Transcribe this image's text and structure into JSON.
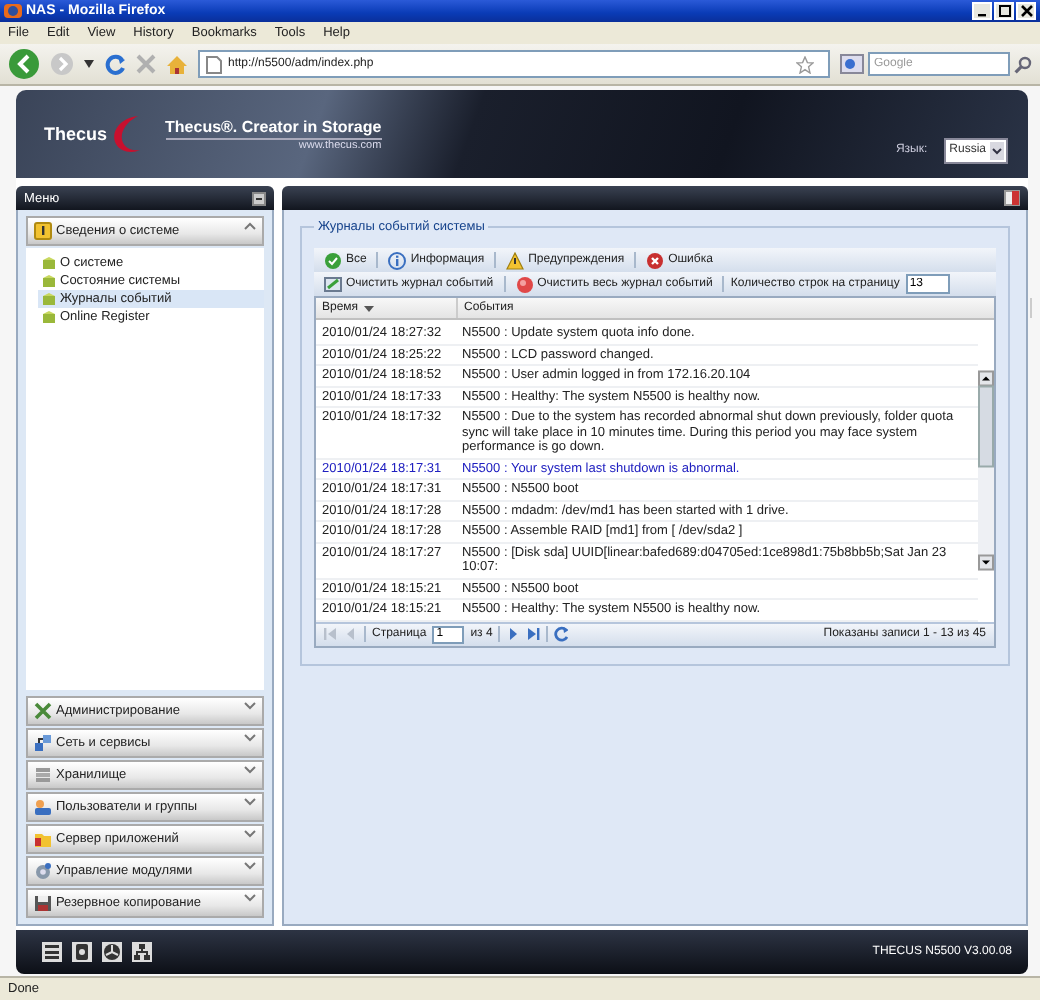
{
  "window": {
    "title": "NAS - Mozilla Firefox"
  },
  "menu_bar": [
    "File",
    "Edit",
    "View",
    "History",
    "Bookmarks",
    "Tools",
    "Help"
  ],
  "address_bar": {
    "url": "http://n5500/adm/index.php"
  },
  "search": {
    "placeholder": "Google"
  },
  "header": {
    "logo": "Thecus",
    "tagline": "Thecus®. Creator in Storage",
    "website": "www.thecus.com",
    "language_label": "Язык:",
    "language": "Russia"
  },
  "sidebar": {
    "title": "Меню",
    "sections": [
      {
        "label": "Сведения о системе",
        "expanded": true,
        "items": [
          {
            "label": "О системе",
            "selected": false
          },
          {
            "label": "Состояние системы",
            "selected": false
          },
          {
            "label": "Журналы событий",
            "selected": true
          },
          {
            "label": "Online Register",
            "selected": false
          }
        ]
      },
      {
        "label": "Администрирование",
        "expanded": false
      },
      {
        "label": "Сеть и сервисы",
        "expanded": false
      },
      {
        "label": "Хранилище",
        "expanded": false
      },
      {
        "label": "Пользователи и группы",
        "expanded": false
      },
      {
        "label": "Сервер приложений",
        "expanded": false
      },
      {
        "label": "Управление модулями",
        "expanded": false
      },
      {
        "label": "Резервное копирование",
        "expanded": false
      }
    ]
  },
  "log_panel": {
    "title": "Журналы событий системы",
    "filters": [
      {
        "kind": "all",
        "label": "Все"
      },
      {
        "kind": "info",
        "label": "Информация"
      },
      {
        "kind": "warning",
        "label": "Предупреждения"
      },
      {
        "kind": "error",
        "label": "Ошибка"
      }
    ],
    "actions": [
      {
        "kind": "clear",
        "label": "Очистить журнал событий"
      },
      {
        "kind": "clear_all",
        "label": "Очистить весь журнал событий"
      }
    ],
    "rows_per_page_label": "Количество строк на страницу",
    "rows_per_page": "13",
    "columns": [
      {
        "label": "Время",
        "sorted": true
      },
      {
        "label": "События",
        "sorted": false
      }
    ],
    "rows": [
      {
        "time": "2010/01/24 18:27:32",
        "event": "N5500 : Update system quota info done.",
        "kind": "normal"
      },
      {
        "time": "2010/01/24 18:25:22",
        "event": "N5500 : LCD password changed.",
        "kind": "normal"
      },
      {
        "time": "2010/01/24 18:18:52",
        "event": "N5500 : User admin logged in from 172.16.20.104",
        "kind": "normal"
      },
      {
        "time": "2010/01/24 18:17:33",
        "event": "N5500 : Healthy: The system N5500 is healthy now.",
        "kind": "normal"
      },
      {
        "time": "2010/01/24 18:17:32",
        "event": "N5500 : Due to the system has recorded abnormal shut down previously, folder quota sync will take place in 10 minutes time. During this period you may face system performance is go down.",
        "kind": "normal"
      },
      {
        "time": "2010/01/24 18:17:31",
        "event": "N5500 : Your system last shutdown is abnormal.",
        "kind": "warning"
      },
      {
        "time": "2010/01/24 18:17:31",
        "event": "N5500 : N5500 boot",
        "kind": "normal"
      },
      {
        "time": "2010/01/24 18:17:28",
        "event": "N5500 : mdadm: /dev/md1 has been started with 1 drive.",
        "kind": "normal"
      },
      {
        "time": "2010/01/24 18:17:28",
        "event": "N5500 : Assemble RAID [md1] from [ /dev/sda2 ]",
        "kind": "normal"
      },
      {
        "time": "2010/01/24 18:17:27",
        "event": "N5500 : [Disk sda] UUID[linear:bafed689:d04705ed:1ce898d1:75b8bb5b;Sat Jan 23 10:07:",
        "kind": "normal"
      },
      {
        "time": "2010/01/24 18:15:21",
        "event": "N5500 : N5500 boot",
        "kind": "normal"
      },
      {
        "time": "2010/01/24 18:15:21",
        "event": "N5500 : Healthy: The system N5500 is healthy now.",
        "kind": "normal"
      }
    ],
    "pager": {
      "page_label": "Страница",
      "page": "1",
      "of_label": "из 4",
      "summary": "Показаны записи 1 - 13 из 45",
      "buttons": [
        {
          "kind": "first",
          "disabled": true
        },
        {
          "kind": "prev",
          "disabled": true
        },
        {
          "kind": "next",
          "disabled": false
        },
        {
          "kind": "last",
          "disabled": false
        },
        {
          "kind": "refresh",
          "disabled": false
        }
      ]
    }
  },
  "footer": {
    "version": "THECUS N5500 V3.00.08"
  },
  "status_bar": "Done"
}
